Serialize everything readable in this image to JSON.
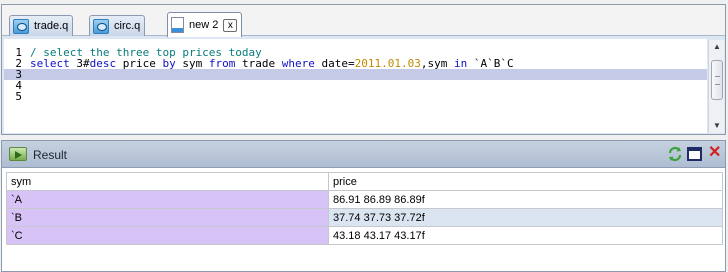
{
  "tabs": [
    {
      "label": "trade.q",
      "icon": "q-file-icon",
      "active": false
    },
    {
      "label": "circ.q",
      "icon": "q-file-icon",
      "active": false
    },
    {
      "label": "new 2",
      "icon": "document-icon",
      "active": true,
      "close_label": "x"
    }
  ],
  "editor": {
    "line_numbers": [
      "1",
      "2",
      "3",
      "4",
      "5"
    ],
    "current_line": 3,
    "lines": [
      [
        {
          "type": "comment",
          "text": "/ select the three top prices today"
        }
      ],
      [
        {
          "type": "kw",
          "text": "select"
        },
        {
          "type": "plain",
          "text": " 3#"
        },
        {
          "type": "kw",
          "text": "desc"
        },
        {
          "type": "plain",
          "text": " price "
        },
        {
          "type": "kw",
          "text": "by"
        },
        {
          "type": "plain",
          "text": " sym "
        },
        {
          "type": "kw",
          "text": "from"
        },
        {
          "type": "plain",
          "text": " trade "
        },
        {
          "type": "kw",
          "text": "where"
        },
        {
          "type": "plain",
          "text": " date="
        },
        {
          "type": "num",
          "text": "2011.01.03"
        },
        {
          "type": "plain",
          "text": ",sym "
        },
        {
          "type": "kw",
          "text": "in"
        },
        {
          "type": "sym",
          "text": " `A`B`C"
        }
      ],
      [],
      [],
      []
    ]
  },
  "result": {
    "title": "Result",
    "columns": [
      "sym",
      "price"
    ],
    "rows": [
      [
        "`A",
        "86.91 86.89 86.89f"
      ],
      [
        "`B",
        "37.74 37.73 37.72f"
      ],
      [
        "`C",
        "43.18 43.17 43.17f"
      ]
    ]
  },
  "colors": {
    "key_column": "#d8c3f7",
    "alt_row": "#dbe4f1",
    "keyword": "#1010c8",
    "comment": "#0a7b7b",
    "date_literal": "#c08a00",
    "close_red": "#d2201e"
  }
}
